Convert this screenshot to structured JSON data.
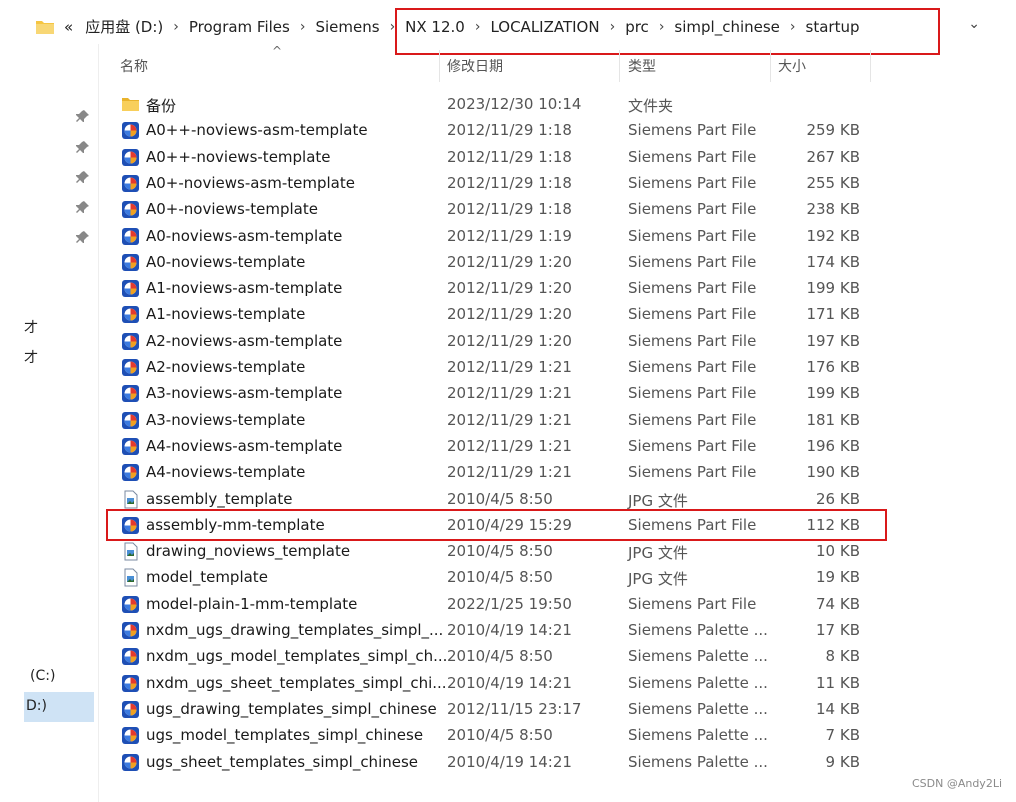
{
  "address_bar": {
    "crumbs": [
      "«",
      "应用盘 (D:)",
      "Program Files",
      "Siemens",
      "NX 12.0",
      "LOCALIZATION",
      "prc",
      "simpl_chinese",
      "startup"
    ],
    "dropdown": "⌄"
  },
  "columns": {
    "name": "名称",
    "date": "修改日期",
    "type": "类型",
    "size": "大小"
  },
  "left_pane": {
    "drive_c": "(C:)",
    "drive_d": "D:)",
    "mark1": "才",
    "mark2": "才"
  },
  "files": [
    {
      "name": "备份",
      "date": "2023/12/30 10:14",
      "type": "文件夹",
      "size": "",
      "icon": "folder-icon"
    },
    {
      "name": "A0++-noviews-asm-template",
      "date": "2012/11/29 1:18",
      "type": "Siemens Part File",
      "size": "259 KB",
      "icon": "nx-part-icon"
    },
    {
      "name": "A0++-noviews-template",
      "date": "2012/11/29 1:18",
      "type": "Siemens Part File",
      "size": "267 KB",
      "icon": "nx-part-icon"
    },
    {
      "name": "A0+-noviews-asm-template",
      "date": "2012/11/29 1:18",
      "type": "Siemens Part File",
      "size": "255 KB",
      "icon": "nx-part-icon"
    },
    {
      "name": "A0+-noviews-template",
      "date": "2012/11/29 1:18",
      "type": "Siemens Part File",
      "size": "238 KB",
      "icon": "nx-part-icon"
    },
    {
      "name": "A0-noviews-asm-template",
      "date": "2012/11/29 1:19",
      "type": "Siemens Part File",
      "size": "192 KB",
      "icon": "nx-part-icon"
    },
    {
      "name": "A0-noviews-template",
      "date": "2012/11/29 1:20",
      "type": "Siemens Part File",
      "size": "174 KB",
      "icon": "nx-part-icon"
    },
    {
      "name": "A1-noviews-asm-template",
      "date": "2012/11/29 1:20",
      "type": "Siemens Part File",
      "size": "199 KB",
      "icon": "nx-part-icon"
    },
    {
      "name": "A1-noviews-template",
      "date": "2012/11/29 1:20",
      "type": "Siemens Part File",
      "size": "171 KB",
      "icon": "nx-part-icon"
    },
    {
      "name": "A2-noviews-asm-template",
      "date": "2012/11/29 1:20",
      "type": "Siemens Part File",
      "size": "197 KB",
      "icon": "nx-part-icon"
    },
    {
      "name": "A2-noviews-template",
      "date": "2012/11/29 1:21",
      "type": "Siemens Part File",
      "size": "176 KB",
      "icon": "nx-part-icon"
    },
    {
      "name": "A3-noviews-asm-template",
      "date": "2012/11/29 1:21",
      "type": "Siemens Part File",
      "size": "199 KB",
      "icon": "nx-part-icon"
    },
    {
      "name": "A3-noviews-template",
      "date": "2012/11/29 1:21",
      "type": "Siemens Part File",
      "size": "181 KB",
      "icon": "nx-part-icon"
    },
    {
      "name": "A4-noviews-asm-template",
      "date": "2012/11/29 1:21",
      "type": "Siemens Part File",
      "size": "196 KB",
      "icon": "nx-part-icon"
    },
    {
      "name": "A4-noviews-template",
      "date": "2012/11/29 1:21",
      "type": "Siemens Part File",
      "size": "190 KB",
      "icon": "nx-part-icon"
    },
    {
      "name": "assembly_template",
      "date": "2010/4/5 8:50",
      "type": "JPG 文件",
      "size": "26 KB",
      "icon": "jpg-file-icon"
    },
    {
      "name": "assembly-mm-template",
      "date": "2010/4/29 15:29",
      "type": "Siemens Part File",
      "size": "112 KB",
      "icon": "nx-part-icon"
    },
    {
      "name": "drawing_noviews_template",
      "date": "2010/4/5 8:50",
      "type": "JPG 文件",
      "size": "10 KB",
      "icon": "jpg-file-icon"
    },
    {
      "name": "model_template",
      "date": "2010/4/5 8:50",
      "type": "JPG 文件",
      "size": "19 KB",
      "icon": "jpg-file-icon"
    },
    {
      "name": "model-plain-1-mm-template",
      "date": "2022/1/25 19:50",
      "type": "Siemens Part File",
      "size": "74 KB",
      "icon": "nx-part-icon"
    },
    {
      "name": "nxdm_ugs_drawing_templates_simpl_...",
      "date": "2010/4/19 14:21",
      "type": "Siemens Palette ...",
      "size": "17 KB",
      "icon": "nx-part-icon"
    },
    {
      "name": "nxdm_ugs_model_templates_simpl_ch...",
      "date": "2010/4/5 8:50",
      "type": "Siemens Palette ...",
      "size": "8 KB",
      "icon": "nx-part-icon"
    },
    {
      "name": "nxdm_ugs_sheet_templates_simpl_chi...",
      "date": "2010/4/19 14:21",
      "type": "Siemens Palette ...",
      "size": "11 KB",
      "icon": "nx-part-icon"
    },
    {
      "name": "ugs_drawing_templates_simpl_chinese",
      "date": "2012/11/15 23:17",
      "type": "Siemens Palette ...",
      "size": "14 KB",
      "icon": "nx-part-icon"
    },
    {
      "name": "ugs_model_templates_simpl_chinese",
      "date": "2010/4/5 8:50",
      "type": "Siemens Palette ...",
      "size": "7 KB",
      "icon": "nx-part-icon"
    },
    {
      "name": "ugs_sheet_templates_simpl_chinese",
      "date": "2010/4/19 14:21",
      "type": "Siemens Palette ...",
      "size": "9 KB",
      "icon": "nx-part-icon"
    }
  ],
  "watermark": "CSDN @Andy2Li",
  "colors": {
    "highlight_box": "#d9191a",
    "selected_nav": "#cfe3f5"
  }
}
